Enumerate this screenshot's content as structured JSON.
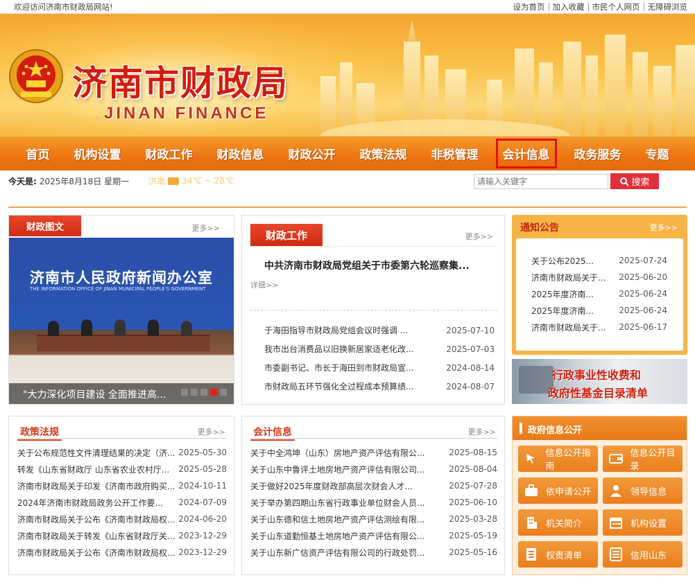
{
  "topbar": {
    "welcome": "欢迎访问济南市财政局网站!",
    "links": [
      "设为首页",
      "加入收藏",
      "市民个人网页",
      "无障碍浏览"
    ]
  },
  "banner": {
    "title": "济南市财政局",
    "subtitle": "JINAN  FINANCE"
  },
  "nav": {
    "items": [
      "首页",
      "机构设置",
      "财政工作",
      "财政信息",
      "财政公开",
      "政策法规",
      "非税管理",
      "会计信息",
      "政务服务",
      "专题"
    ],
    "active_index": 7
  },
  "infobar": {
    "today_label": "今天是:",
    "date": "2025年8月18日 星期一",
    "city": "济南",
    "temp": "34℃ ~ 28℃",
    "search_placeholder": "请输入关键字",
    "search_button": "搜索"
  },
  "photo_news": {
    "tab": "财政图文",
    "more": "更多>>",
    "slide_heading": "济南市人民政府新闻办公室",
    "slide_heading_en": "THE INFORMATION OFFICE OF JINAN MUNICIPAL PEOPLE'S GOVERNMENT",
    "caption": "\"大力深化项目建设 全面推进高...",
    "active_slide": 4
  },
  "finance_work": {
    "tab": "财政工作",
    "more": "更多>>",
    "headline": "中共济南市财政局党组关于市委第六轮巡察集...",
    "detail": "详细>>",
    "items": [
      {
        "title": "于海田指导市财政局党组会议时强调 ...",
        "date": "2025-07-10"
      },
      {
        "title": "我市出台消费品以旧换新居家适老化改...",
        "date": "2025-07-03"
      },
      {
        "title": "市委副书记、市长于海田到市财政局宣...",
        "date": "2024-08-14"
      },
      {
        "title": "市财政局五环节强化全过程成本预算绩...",
        "date": "2024-08-07"
      }
    ]
  },
  "notices": {
    "title": "通知公告",
    "more": "更多>>",
    "items": [
      {
        "title": "关于公布2025...",
        "date": "2025-07-24"
      },
      {
        "title": "济南市财政局关于...",
        "date": "2025-06-20"
      },
      {
        "title": "2025年度济南...",
        "date": "2025-06-24"
      },
      {
        "title": "2025年度济南...",
        "date": "2025-06-24"
      },
      {
        "title": "济南市财政局关于...",
        "date": "2025-06-17"
      }
    ]
  },
  "fee_banner": {
    "line1": "行政事业性收费和",
    "line2": "政府性基金目录清单"
  },
  "policy": {
    "title": "政策法规",
    "more": "更多>>",
    "items": [
      {
        "title": "关于公布规范性文件清理结果的决定（济...",
        "date": "2025-05-30"
      },
      {
        "title": "转发《山东省财政厅 山东省农业农村厅...",
        "date": "2025-05-28"
      },
      {
        "title": "济南市财政局关于印发《济南市政府购买...",
        "date": "2024-10-11"
      },
      {
        "title": "2024年济南市财政局政务公开工作要...",
        "date": "2024-07-09"
      },
      {
        "title": "济南市财政局关于公布《济南市财政局权...",
        "date": "2024-06-20"
      },
      {
        "title": "济南市财政局关于转发《山东省财政厅关...",
        "date": "2023-12-29"
      },
      {
        "title": "济南市财政局关于公布《济南市财政局权...",
        "date": "2023-12-29"
      }
    ]
  },
  "accounting": {
    "title": "会计信息",
    "more": "更多>>",
    "items": [
      {
        "title": "关于中全鸿坤（山东）房地产资产评估有限公...",
        "date": "2025-08-15"
      },
      {
        "title": "关于山东中鲁评土地房地产资产评估有限公司...",
        "date": "2025-08-04"
      },
      {
        "title": "关于做好2025年度财政部高层次财会人才...",
        "date": "2025-07-28"
      },
      {
        "title": "关于举办第四期山东省行政事业单位财会人员...",
        "date": "2025-06-10"
      },
      {
        "title": "关于山东德和信土地房地产资产评估测绘有限...",
        "date": "2025-03-28"
      },
      {
        "title": "关于山东道勤恒基土地房地产资产评估有限公...",
        "date": "2025-05-19"
      },
      {
        "title": "关于山东新广信资产评估有限公司的行政处罚...",
        "date": "2025-05-16"
      }
    ]
  },
  "gov_info": {
    "title": "政府信息公开",
    "buttons": [
      {
        "label": "信息公开指南",
        "icon": "cursor-icon"
      },
      {
        "label": "信息公开目录",
        "icon": "wallet-icon"
      },
      {
        "label": "依申请公开",
        "icon": "briefcase-icon"
      },
      {
        "label": "领导信息",
        "icon": "person-icon"
      },
      {
        "label": "机关简介",
        "icon": "building-icon"
      },
      {
        "label": "机构设置",
        "icon": "calendar-icon"
      },
      {
        "label": "权责清单",
        "icon": "document-icon"
      },
      {
        "label": "信用山东",
        "icon": "list-icon"
      }
    ]
  },
  "colors": {
    "accent": "#ee7512",
    "brand_red": "#d21c10",
    "date_red": "#cc2222"
  }
}
